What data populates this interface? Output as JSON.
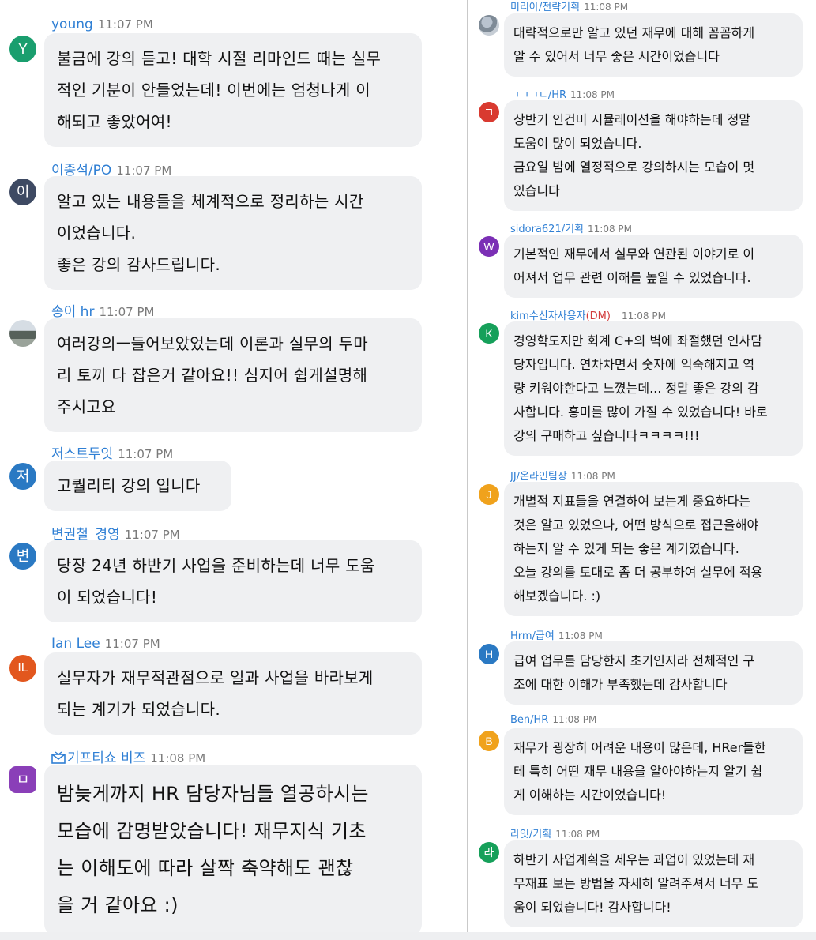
{
  "left_messages": [
    {
      "avatar": "Y",
      "avatar_color": "#1a9e6e",
      "name": "young",
      "time": "11:07 PM",
      "lines": [
        "불금에 강의 듣고! 대학 시절 리마인드 때는 실무",
        "적인 기분이 안들었는데! 이번에는 엄청나게 이",
        "해되고 좋았어여!"
      ]
    },
    {
      "avatar": "이",
      "avatar_color": "#3e4a63",
      "name": "이종석/PO",
      "time": "11:07 PM",
      "lines": [
        "알고 있는 내용들을 체계적으로 정리하는 시간",
        "이었습니다.",
        "좋은 강의 감사드립니다."
      ]
    },
    {
      "avatar": "",
      "avatar_color": "#8f9aa0",
      "name": "송이 hr",
      "time": "11:07 PM",
      "lines": [
        "여러강의ㅡ들어보았었는데 이론과 실무의 두마",
        "리 토끼 다 잡은거 같아요!! 심지어 쉽게설명해",
        "주시고요"
      ]
    },
    {
      "avatar": "저",
      "avatar_color": "#2a79c3",
      "name": "저스트두잇",
      "time": "11:07 PM",
      "lines": [
        "고퀄리티 강의 입니다"
      ]
    },
    {
      "avatar": "변",
      "avatar_color": "#2a79c3",
      "name": "변권철_경영",
      "time": "11:07 PM",
      "lines": [
        "당장 24년 하반기 사업을 준비하는데 너무 도움",
        "이 되었습니다!"
      ]
    },
    {
      "avatar": "IL",
      "avatar_color": "#e2571e",
      "name": "Ian Lee",
      "time": "11:07 PM",
      "lines": [
        "실무자가 재무적관점으로 일과 사업을 바라보게",
        "되는 계기가 되었습니다."
      ]
    },
    {
      "avatar": "ㅁ",
      "avatar_color": "#8a3fb8",
      "name": "기프티쇼 비즈",
      "time": "11:08 PM",
      "lines": [
        "밤늦게까지 HR 담당자님들 열공하시는",
        "모습에 감명받았습니다! 재무지식 기초",
        "는 이해도에 따라 살짝 축약해도 괜찮",
        "을 거 같아요 :)"
      ]
    }
  ],
  "right_messages": [
    {
      "avatar": "",
      "avatar_color": "#9aa6b2",
      "name": "미리아/전략기획",
      "time": "11:08 PM",
      "dm": "",
      "lines": [
        "대략적으로만 알고 있던 재무에 대해 꼼꼼하게",
        "알 수 있어서 너무 좋은 시간이었습니다"
      ]
    },
    {
      "avatar": "ㄱ",
      "avatar_color": "#d93a30",
      "name": "ㄱㄱㄱㄷ/HR",
      "time": "11:08 PM",
      "dm": "",
      "lines": [
        "상반기 인건비 시뮬레이션을 해야하는데 정말",
        "도움이 많이 되었습니다.",
        "금요일 밤에 열정적으로 강의하시는 모습이 멋",
        "있습니다"
      ]
    },
    {
      "avatar": "W",
      "avatar_color": "#7b2fb5",
      "name": "sidora621/기획",
      "time": "11:08 PM",
      "dm": "",
      "lines": [
        "기본적인 재무에서 실무와 연관된 이야기로 이",
        "어져서 업무 관련 이해를 높일 수 있었습니다."
      ]
    },
    {
      "avatar": "K",
      "avatar_color": "#16a05a",
      "name": "kim수신자사용자",
      "time": "11:08 PM",
      "dm": "(DM)",
      "lines": [
        "경영학도지만 회계 C+의 벽에 좌절했던 인사담",
        "당자입니다. 연차차면서 숫자에 익숙해지고 역",
        "량 키워야한다고 느꼈는데... 정말 좋은 강의 감",
        "사합니다. 흥미를 많이 가질 수 있었습니다! 바로",
        "강의 구매하고 싶습니다ㅋㅋㅋㅋ!!!"
      ]
    },
    {
      "avatar": "J",
      "avatar_color": "#f0a21c",
      "name": "JJ/온라인팀장",
      "time": "11:08 PM",
      "dm": "",
      "lines": [
        "개별적 지표들을 연결하여 보는게 중요하다는",
        "것은 알고 있었으나, 어떤 방식으로 접근을해야",
        "하는지 알 수 있게 되는 좋은 계기였습니다.",
        "오늘 강의를 토대로 좀 더 공부하여 실무에 적용",
        "해보겠습니다. :)"
      ]
    },
    {
      "avatar": "H",
      "avatar_color": "#2a79c3",
      "name": "Hrm/급여",
      "time": "11:08 PM",
      "dm": "",
      "lines": [
        "급여 업무를 담당한지 초기인지라 전체적인 구",
        "조에 대한 이해가 부족했는데 감사합니다"
      ]
    },
    {
      "avatar": "B",
      "avatar_color": "#f0a21c",
      "name": "Ben/HR",
      "time": "11:08 PM",
      "dm": "",
      "lines": [
        "재무가 굉장히 어려운 내용이 많은데, HRer들한",
        "테 특히 어떤 재무 내용을 알아야하는지 알기 쉽",
        "게 이해하는 시간이었습니다!"
      ]
    },
    {
      "avatar": "라",
      "avatar_color": "#16a05a",
      "name": "라잇/기획",
      "time": "11:08 PM",
      "dm": "",
      "lines": [
        "하반기 사업계획을 세우는 과업이 있었는데 재",
        "무재표 보는 방법을 자세히 알려주셔서 너무 도",
        "움이 되었습니다! 감사합니다!"
      ]
    }
  ]
}
